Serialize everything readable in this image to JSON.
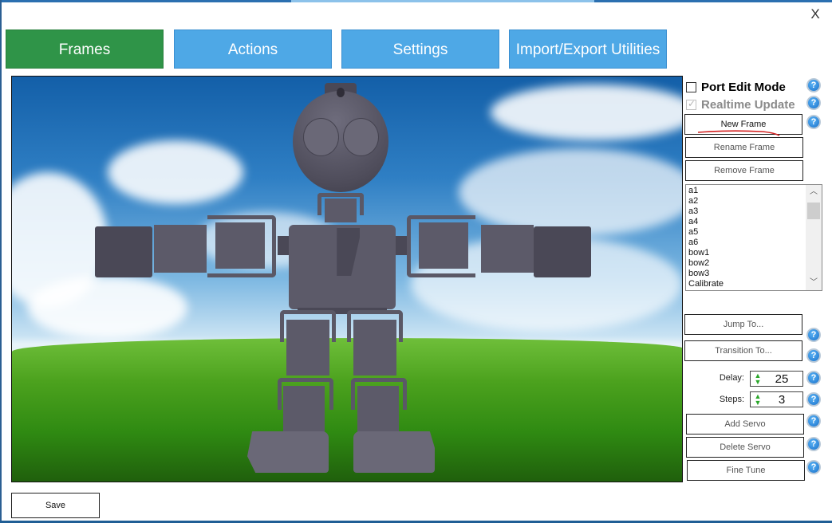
{
  "window": {
    "close_label": "X"
  },
  "tabs": [
    {
      "label": "Frames",
      "active": true
    },
    {
      "label": "Actions",
      "active": false
    },
    {
      "label": "Settings",
      "active": false
    },
    {
      "label": "Import/Export Utilities",
      "active": false
    }
  ],
  "colors": {
    "tab_active": "#2f9448",
    "tab_inactive": "#4ea8e6",
    "help_icon": "#1a72cc",
    "stepper_arrows": "#2aa72a",
    "annotation_underline": "#d22020"
  },
  "viewport": {
    "scene": "3D humanoid robot model on sky and grass background"
  },
  "panel": {
    "port_edit_mode": {
      "label": "Port Edit Mode",
      "checked": false,
      "enabled": true
    },
    "realtime_update": {
      "label": "Realtime Update",
      "checked": true,
      "enabled": false
    },
    "buttons": {
      "new_frame": "New Frame",
      "rename_frame": "Rename Frame",
      "remove_frame": "Remove Frame",
      "jump_to": "Jump To...",
      "transition_to": "Transition To...",
      "add_servo": "Add Servo",
      "delete_servo": "Delete Servo",
      "fine_tune": "Fine Tune"
    },
    "frames_list": [
      "a1",
      "a2",
      "a3",
      "a4",
      "a5",
      "a6",
      "bow1",
      "bow2",
      "bow3",
      "Calibrate"
    ],
    "delay": {
      "label": "Delay:",
      "value": "25"
    },
    "steps": {
      "label": "Steps:",
      "value": "3"
    },
    "help_glyph": "?"
  },
  "footer": {
    "save_label": "Save"
  }
}
